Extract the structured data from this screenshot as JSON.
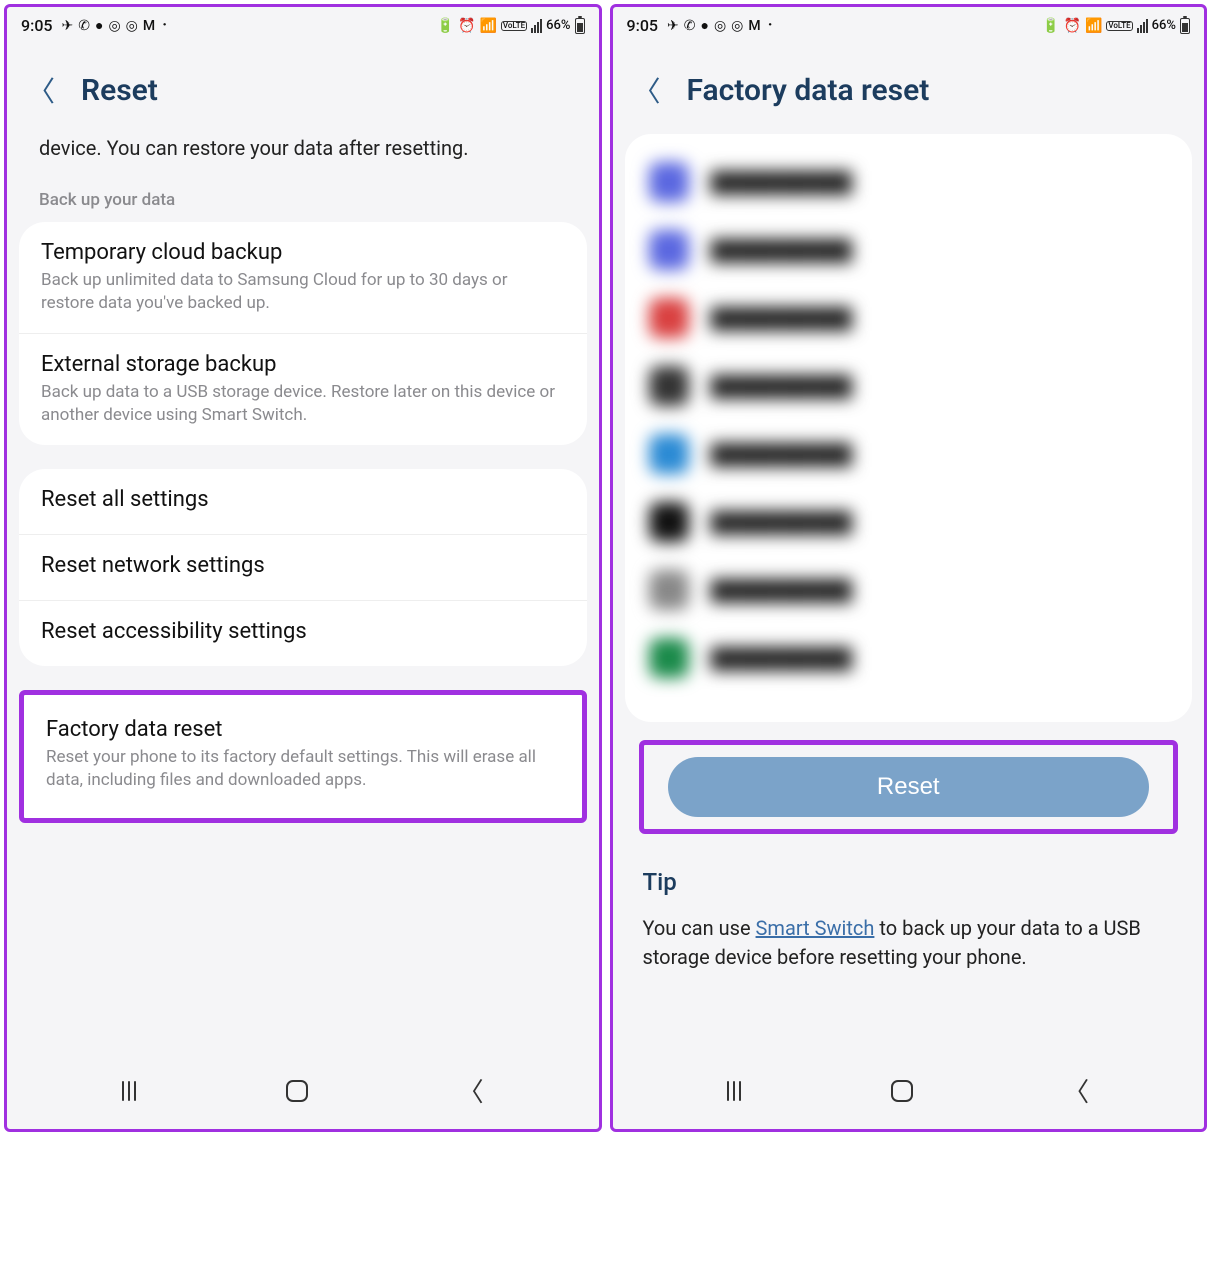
{
  "status": {
    "time": "9:05",
    "battery_pct": "66%"
  },
  "left": {
    "title": "Reset",
    "intro": "device. You can restore your data after resetting.",
    "backup_label": "Back up your data",
    "backup_items": [
      {
        "title": "Temporary cloud backup",
        "desc": "Back up unlimited data to Samsung Cloud for up to 30 days or restore data you've backed up."
      },
      {
        "title": "External storage backup",
        "desc": "Back up data to a USB storage device. Restore later on this device or another device using Smart Switch."
      }
    ],
    "reset_items": [
      {
        "title": "Reset all settings"
      },
      {
        "title": "Reset network settings"
      },
      {
        "title": "Reset accessibility settings"
      }
    ],
    "factory": {
      "title": "Factory data reset",
      "desc": "Reset your phone to its factory default settings. This will erase all data, including files and downloaded apps."
    }
  },
  "right": {
    "title": "Factory data reset",
    "reset_button": "Reset",
    "tip_heading": "Tip",
    "tip_before": "You can use ",
    "tip_link": "Smart Switch",
    "tip_after": " to back up your data to a USB storage device before resetting your phone.",
    "app_colors": [
      "#5a67e0",
      "#5a67e0",
      "#d94040",
      "#333",
      "#2a8ad4",
      "#111",
      "#888",
      "#1a8a4a"
    ]
  }
}
